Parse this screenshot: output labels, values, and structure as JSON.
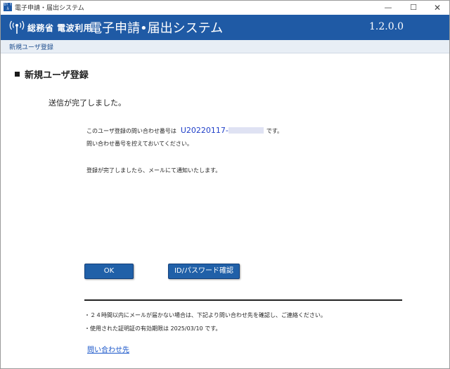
{
  "window": {
    "title": "電子申請・届出システム",
    "app_icon_text": "ﾓﾊﾞｲﾙ",
    "minimize_glyph": "—",
    "maximize_glyph": "☐",
    "close_glyph": "✕"
  },
  "header": {
    "ministry": "総務省 電波利用",
    "system_title": "電子申請•届出システム",
    "version": "1.2.0.0",
    "background_color": "#1f5aa5"
  },
  "breadcrumb": "新規ユーザ登録",
  "section_title": "新規ユーザ登録",
  "complete_message": "送信が完了しました。",
  "inquiry": {
    "prefix": "このユーザ登録の問い合わせ番号は",
    "number_visible": "U20220117-",
    "suffix": "です。",
    "number_color": "#1e3ec8"
  },
  "keep_notice": "問い合わせ番号を控えておいてください。",
  "notify_notice": "登録が完了しましたら、メールにて通知いたします。",
  "buttons": {
    "ok": "OK",
    "id_password": "ID/パスワード確認"
  },
  "notes": [
    "・２４時間以内にメールが届かない場合は、下記より問い合わせ先を確認し、ご連絡ください。",
    "・使用された証明証の有効期限は 2025/03/10 です。"
  ],
  "contact_link": "問い合わせ先",
  "icons": {
    "app": "app-icon",
    "antenna": "antenna-icon"
  }
}
